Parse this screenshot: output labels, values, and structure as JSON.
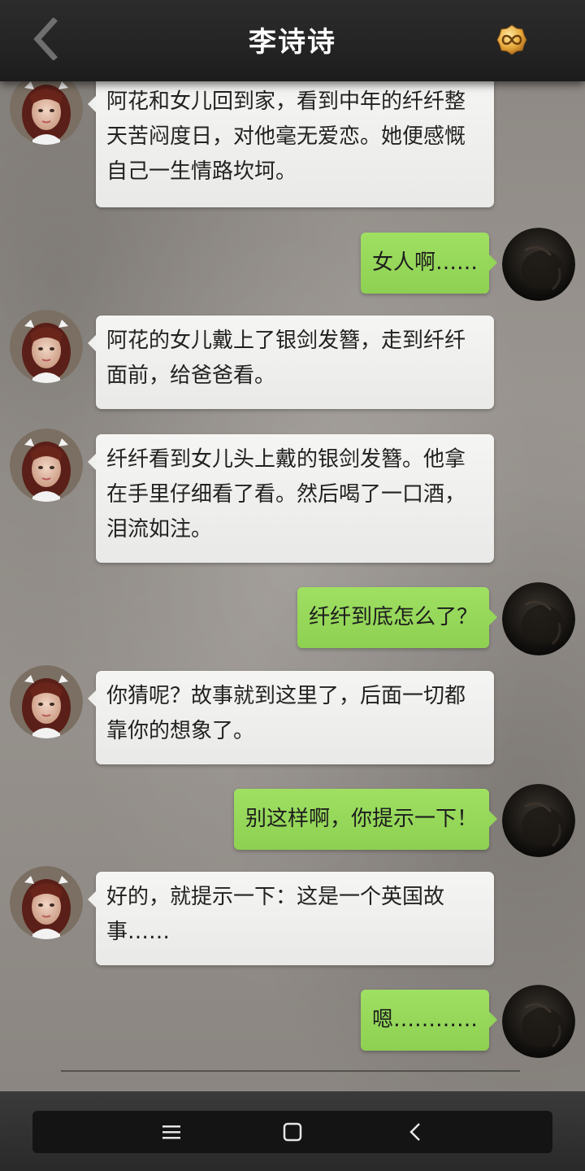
{
  "header": {
    "title": "李诗诗",
    "back_icon": "chevron-left-icon",
    "badge_icon": "infinity-badge-icon"
  },
  "colors": {
    "sent_bubble": "#96d75a",
    "received_bubble": "#f0f0ee",
    "header_bg": "#262626"
  },
  "messages": [
    {
      "side": "left",
      "text": "阿花和女儿回到家，看到中年的纤纤整天苦闷度日，对他毫无爱恋。她便感慨自己一生情路坎坷。"
    },
    {
      "side": "right",
      "text": "女人啊……"
    },
    {
      "side": "left",
      "text": "阿花的女儿戴上了银剑发簪，走到纤纤面前，给爸爸看。"
    },
    {
      "side": "left",
      "text": "纤纤看到女儿头上戴的银剑发簪。他拿在手里仔细看了看。然后喝了一口酒，泪流如注。"
    },
    {
      "side": "right",
      "text": "纤纤到底怎么了？"
    },
    {
      "side": "left",
      "text": "你猜呢？故事就到这里了，后面一切都靠你的想象了。"
    },
    {
      "side": "right",
      "text": "别这样啊，你提示一下！"
    },
    {
      "side": "left",
      "text": "好的，就提示一下：这是一个英国故事……"
    },
    {
      "side": "right",
      "text": "嗯…………"
    }
  ],
  "navbar": {
    "menu_icon": "menu-icon",
    "home_icon": "square-home-icon",
    "back_icon": "back-triangle-icon"
  }
}
